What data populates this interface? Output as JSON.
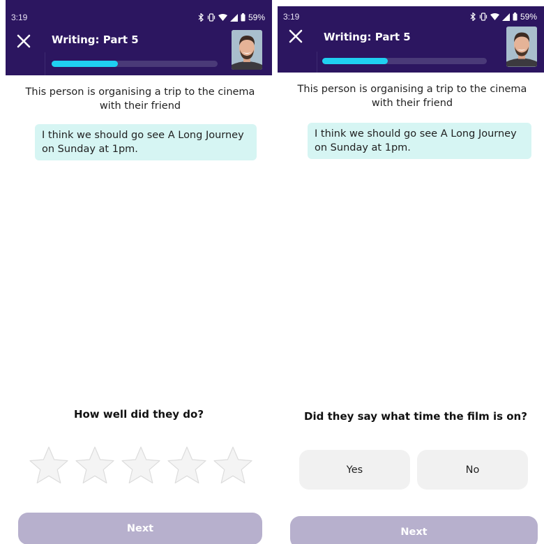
{
  "left_screen": {
    "status_bar": {
      "time": "3:19",
      "battery": "59%",
      "icons": [
        "bluetooth-icon",
        "vibrate-icon",
        "wifi-icon",
        "signal-icon",
        "battery-icon"
      ]
    },
    "app_bar": {
      "title": "Writing: Part 5",
      "close_icon": "close-icon",
      "progress_fraction": 0.4
    },
    "prompt": "This person is organising a trip to the cinema with their friend",
    "message": "I think we should go see A Long Journey on Sunday at 1pm.",
    "question": "How well did they do?",
    "rating": {
      "max_stars": 5,
      "selected": 0
    },
    "next_button": "Next"
  },
  "right_screen": {
    "status_bar": {
      "time": "3:19",
      "battery": "59%",
      "icons": [
        "bluetooth-icon",
        "vibrate-icon",
        "wifi-icon",
        "signal-icon",
        "battery-icon"
      ]
    },
    "app_bar": {
      "title": "Writing: Part 5",
      "close_icon": "close-icon",
      "progress_fraction": 0.4
    },
    "prompt": "This person is organising a trip to the cinema with their friend",
    "message": "I think we should go see A Long Journey on Sunday at 1pm.",
    "question": "Did they say what time the film is on?",
    "options": [
      "Yes",
      "No"
    ],
    "next_button": "Next"
  },
  "colors": {
    "app_bar": "#2c1660",
    "progress": "#1fd0f0",
    "bubble": "#d6f5f3",
    "next_disabled": "#b7b0cd"
  }
}
